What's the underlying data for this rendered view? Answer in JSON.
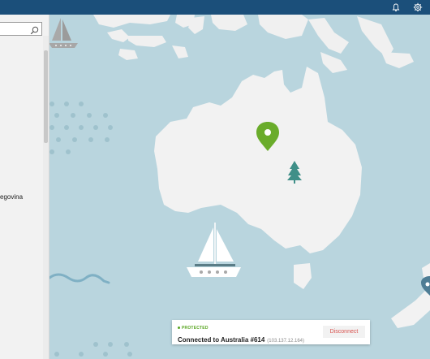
{
  "titlebar": {
    "bell_icon": "bell-icon",
    "settings_icon": "gear-icon"
  },
  "sidebar": {
    "search_placeholder": "",
    "visible_item": "egovina"
  },
  "map": {
    "active_location": "Australia",
    "icons": [
      "sailboat-icon",
      "location-pin-icon",
      "tree-icon",
      "sailboat-icon",
      "location-pin-icon"
    ]
  },
  "status": {
    "label": "PROTECTED",
    "connection_text": "Connected to Australia #614",
    "ip": "(103.137.12.164)",
    "disconnect_label": "Disconnect"
  },
  "colors": {
    "titlebar": "#1b4f7a",
    "ocean": "#b9d5de",
    "land": "#f0f0f0",
    "accent_green": "#6aac2b",
    "protected_green": "#5aa623",
    "disconnect_red": "#d9534f"
  }
}
